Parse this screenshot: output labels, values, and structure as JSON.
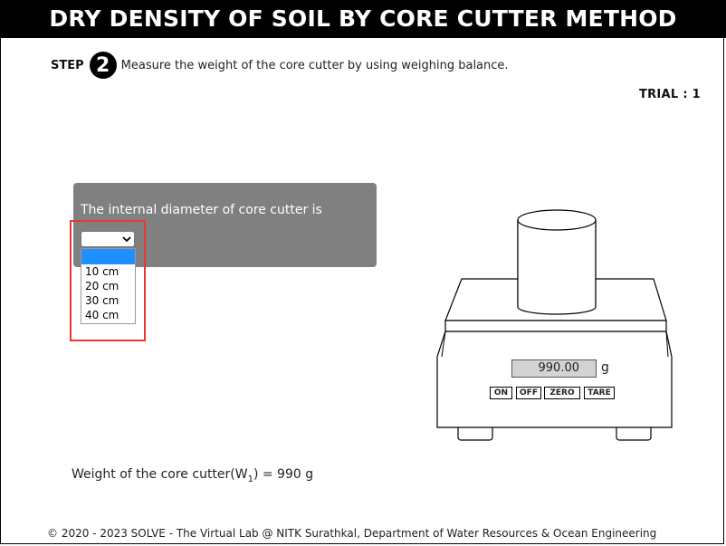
{
  "header": {
    "title": "DRY DENSITY OF SOIL BY CORE CUTTER METHOD"
  },
  "step": {
    "label": "STEP",
    "number": "2",
    "instruction": "Measure the weight of the core cutter by using weighing balance."
  },
  "trial": {
    "text": "TRIAL : 1"
  },
  "question": {
    "text": "The internal diameter of core cutter is",
    "selected": "",
    "options": [
      "10 cm",
      "20 cm",
      "30 cm",
      "40 cm"
    ]
  },
  "balance": {
    "reading": "990.00",
    "unit": "g",
    "buttons": {
      "on": "ON",
      "off": "OFF",
      "zero": "ZERO",
      "tare": "TARE"
    }
  },
  "result": {
    "label_prefix": "Weight of the core cutter(W",
    "label_sub": "1",
    "label_suffix": ") = 990 g"
  },
  "footer": {
    "text": "© 2020 - 2023 SOLVE - The Virtual Lab @ NITK Surathkal, Department of Water Resources & Ocean Engineering"
  },
  "colors": {
    "title_bg": "#000000",
    "question_bg": "#808080",
    "highlight": "#e53935",
    "selected_option": "#1e90ff"
  }
}
